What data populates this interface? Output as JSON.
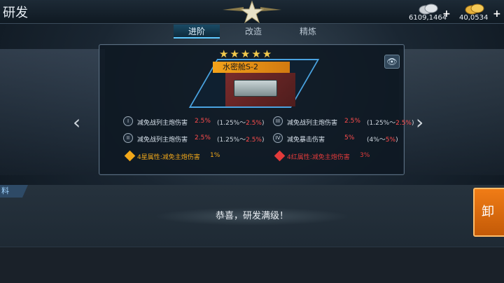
{
  "header": {
    "title": "研发",
    "silver_value": "6109,1464",
    "gold_value": "40,0534",
    "plus": "+"
  },
  "tabs": [
    {
      "label": "进阶",
      "active": true
    },
    {
      "label": "改造",
      "active": false
    },
    {
      "label": "精炼",
      "active": false
    }
  ],
  "item": {
    "stars": "★★★★★",
    "name": "水密舱S-2"
  },
  "stats": [
    {
      "badge": "I",
      "name": "减免战列主炮伤害",
      "pct": "2.5%",
      "range_lo": "(1.25%～",
      "range_hi": "2.5%",
      "range_end": ")"
    },
    {
      "badge": "II",
      "name": "减免战列主炮伤害",
      "pct": "2.5%",
      "range_lo": "(1.25%～",
      "range_hi": "2.5%",
      "range_end": ")"
    },
    {
      "badge": "III",
      "name": "减免战列主炮伤害",
      "pct": "2.5%",
      "range_lo": "(1.25%～",
      "range_hi": "2.5%",
      "range_end": ")"
    },
    {
      "badge": "IV",
      "name": "减免暴击伤害",
      "pct": "5%",
      "range_lo": "(4%～",
      "range_hi": "5%",
      "range_end": ")"
    }
  ],
  "attrs": [
    {
      "text": "4星属性:减免主炮伤害",
      "value": "1%",
      "color": "#f2a81a"
    },
    {
      "text": "4红属性:减免主炮伤害",
      "value": "3%",
      "color": "#e23b3b"
    }
  ],
  "lower": {
    "tab_label": "料",
    "congrats": "恭喜，研发满级！",
    "side_button": "卸"
  },
  "colors": {
    "accent": "#5fc9ff",
    "highlight": "#ff4d4d",
    "orange": "#f07c16"
  }
}
